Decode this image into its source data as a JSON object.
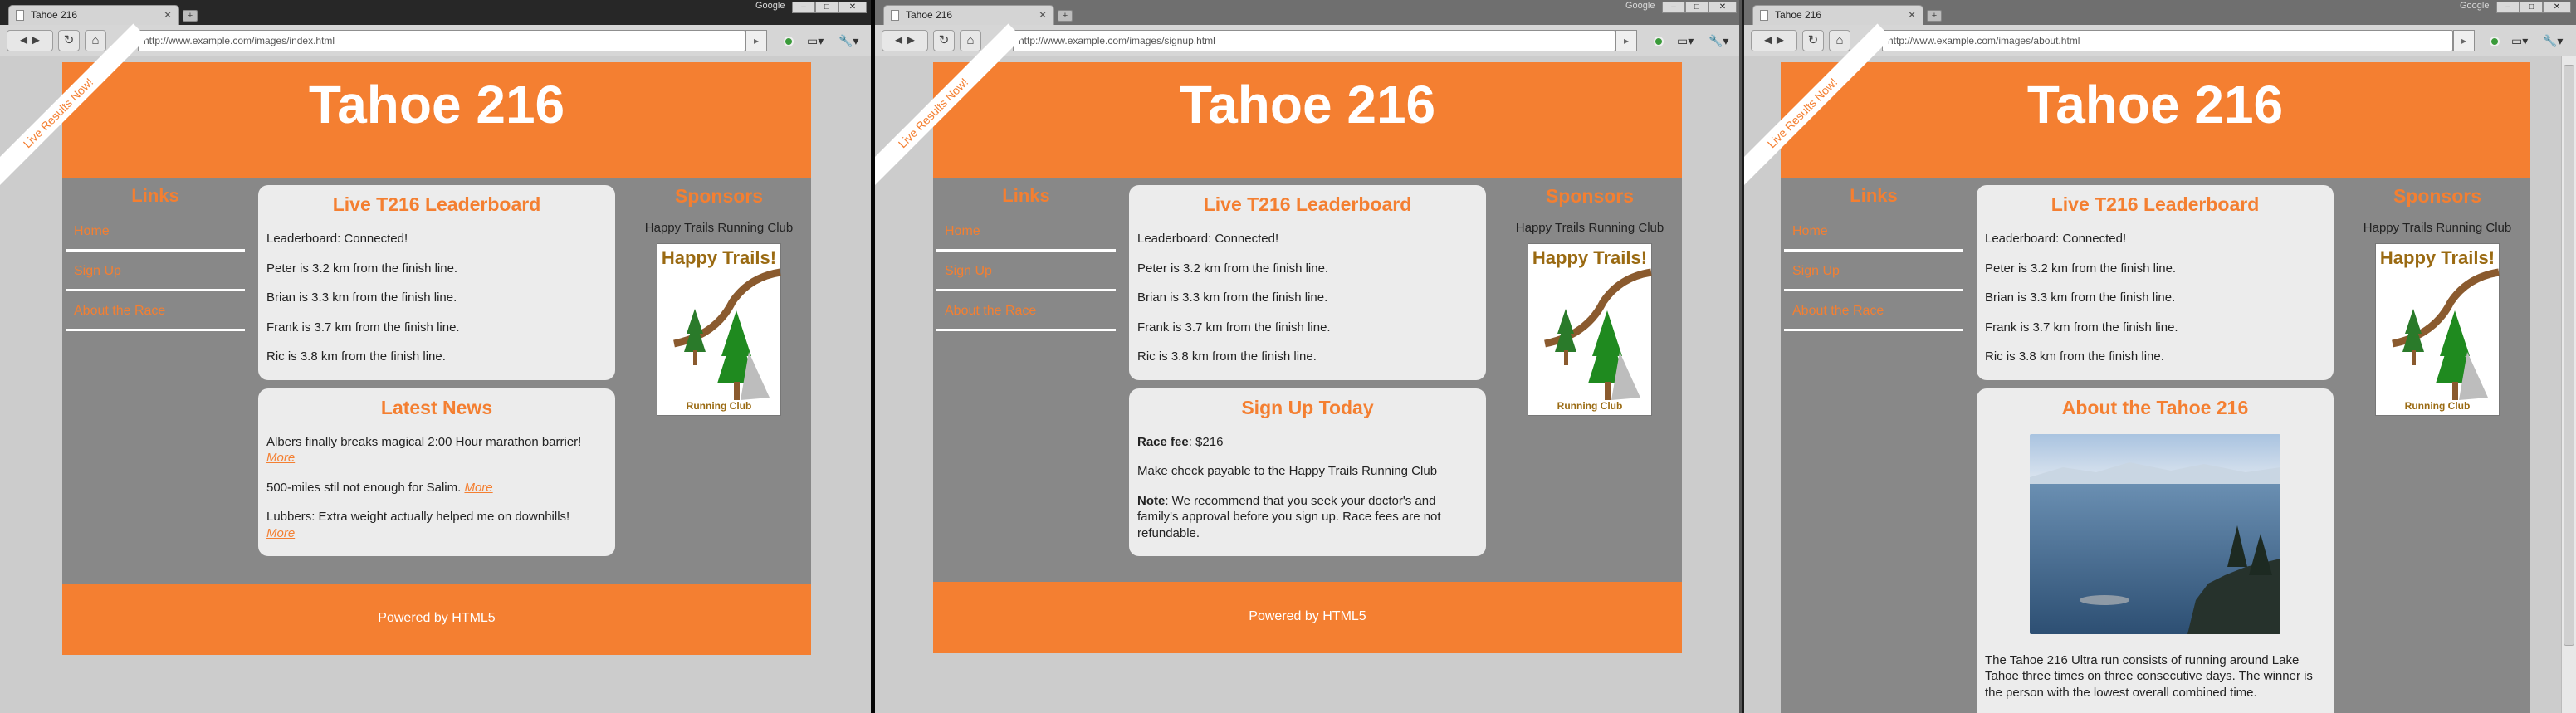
{
  "browser": {
    "tab_title": "Tahoe 216",
    "brand": "Google",
    "new_tab": "+",
    "window_controls": [
      "–",
      "□",
      "✕"
    ],
    "back_label": "◄",
    "forward_label": "►",
    "reload_label": "↻",
    "home_label": "⌂",
    "star_label": "☆",
    "go_label": "▸",
    "page_menu_label": "▭▾",
    "tools_menu_label": "🔧▾"
  },
  "windows": [
    {
      "url": "http://www.example.com/images/index.html",
      "active": true
    },
    {
      "url": "http://www.example.com/images/signup.html",
      "active": false
    },
    {
      "url": "http://www.example.com/images/about.html",
      "active": false
    }
  ],
  "site": {
    "title": "Tahoe 216",
    "ribbon": "Live Results Now!",
    "links_heading": "Links",
    "nav": [
      "Home",
      "Sign Up",
      "About the Race"
    ],
    "sponsors_heading": "Sponsors",
    "sponsor_name": "Happy Trails Running Club",
    "logo_title": "Happy Trails!",
    "logo_footer": "Running Club",
    "footer": "Powered by HTML5",
    "leaderboard": {
      "heading": "Live T216 Leaderboard",
      "lines": [
        "Leaderboard: Connected!",
        "Peter is 3.2 km from the finish line.",
        "Brian is 3.3 km from the finish line.",
        "Frank is 3.7 km from the finish line.",
        "Ric is 3.8 km from the finish line."
      ]
    },
    "news": {
      "heading": "Latest News",
      "more": "More",
      "items": [
        "Albers finally breaks magical 2:00 Hour marathon barrier!",
        "500-miles stil not enough for Salim.",
        "Lubbers: Extra weight actually helped me on downhills!"
      ]
    },
    "signup": {
      "heading": "Sign Up Today",
      "fee_label": "Race fee",
      "fee_value": ": $216",
      "payable": "Make check payable to the Happy Trails Running Club",
      "note_label": "Note",
      "note_text": ": We recommend that you seek your doctor's and family's approval before you sign up. Race fees are not refundable."
    },
    "about": {
      "heading": "About the Tahoe 216",
      "text": "The Tahoe 216 Ultra run consists of running around Lake Tahoe three times on three consecutive days. The winner is the person with the lowest overall combined time."
    }
  }
}
